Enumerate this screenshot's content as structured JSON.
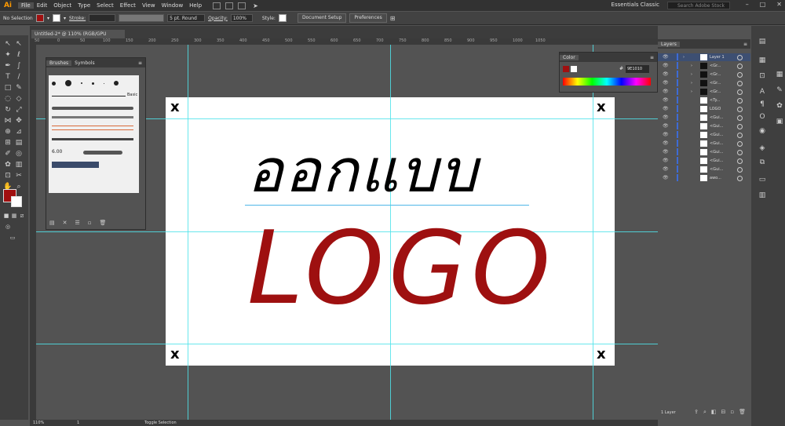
{
  "app": {
    "logo": "Ai",
    "menus": [
      "File",
      "Edit",
      "Object",
      "Type",
      "Select",
      "Effect",
      "View",
      "Window",
      "Help"
    ],
    "workspace": "Essentials Classic",
    "search_placeholder": "Search Adobe Stock",
    "window_buttons": [
      "–",
      "□",
      "✕"
    ]
  },
  "control": {
    "selection": "No Selection",
    "stroke_label": "Stroke:",
    "brush": "5 pt. Round",
    "opacity_label": "Opacity:",
    "opacity": "100%",
    "style_label": "Style:",
    "doc_setup": "Document Setup",
    "preferences": "Preferences",
    "fill_color": "#a01010"
  },
  "document": {
    "tab": "Untitled-2* @ 110% (RGB/GPU Preview)",
    "thai_text": "ออกแบบ",
    "logo_text": "LOGO",
    "corner_mark": "x",
    "text_color": "#9e1010"
  },
  "ruler": [
    "50",
    "0",
    "50",
    "100",
    "150",
    "200",
    "250",
    "300",
    "350",
    "400",
    "450",
    "500",
    "550",
    "600",
    "650",
    "700",
    "750",
    "800",
    "850",
    "900",
    "950",
    "1000",
    "1050"
  ],
  "brushes": {
    "tabs": [
      "Brushes",
      "Symbols"
    ],
    "basic_label": "Basic",
    "size_label": "6.00"
  },
  "color": {
    "title": "Color",
    "hex": "9E1010"
  },
  "layers": {
    "title": "Layers",
    "rows": [
      {
        "name": "Layer 1",
        "type": "layer"
      },
      {
        "name": "<Gr...",
        "type": "group"
      },
      {
        "name": "<Gr...",
        "type": "group"
      },
      {
        "name": "<Gr...",
        "type": "group"
      },
      {
        "name": "<Gr...",
        "type": "group"
      },
      {
        "name": "<Ty...",
        "type": "item"
      },
      {
        "name": "LOGO",
        "type": "item"
      },
      {
        "name": "<Gui...",
        "type": "item"
      },
      {
        "name": "<Gui...",
        "type": "item"
      },
      {
        "name": "<Gui...",
        "type": "item"
      },
      {
        "name": "<Gui...",
        "type": "item"
      },
      {
        "name": "<Gui...",
        "type": "item"
      },
      {
        "name": "<Gui...",
        "type": "item"
      },
      {
        "name": "<Gui...",
        "type": "item"
      },
      {
        "name": "awo...",
        "type": "item"
      }
    ],
    "count": "1 Layer"
  },
  "status": {
    "zoom": "110%",
    "page": "1",
    "tool": "Toggle Selection"
  }
}
